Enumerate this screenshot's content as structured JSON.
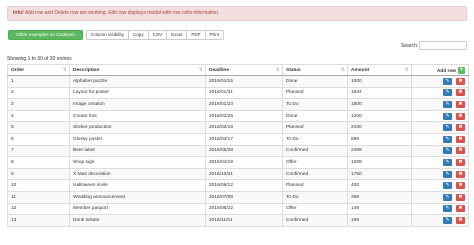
{
  "alert": {
    "strong": "Info!",
    "text": " Add row and Delete row are working. Edit row displays modal with row cells information."
  },
  "toolbar": {
    "examples_label": "Other examples on Codepen",
    "buttons": [
      "Column visibility",
      "Copy",
      "CSV",
      "Excel",
      "PDF",
      "Print"
    ]
  },
  "search": {
    "label": "Search:",
    "value": ""
  },
  "info": "Showing 1 to 30 of 30 entries",
  "table": {
    "headers": [
      "Order",
      "Description",
      "Deadline",
      "Status",
      "Amount"
    ],
    "add_row_label": "Add row",
    "add_icon": "plus-icon",
    "edit_icon": "pencil-icon",
    "delete_icon": "times-icon",
    "colors": {
      "add": "#5cb85c",
      "edit": "#337ab7",
      "delete": "#d9534f"
    },
    "rows": [
      [
        "1",
        "Alphabet puzzle",
        "2016/01/15",
        "Done",
        "1000"
      ],
      [
        "2",
        "Layout for poster",
        "2016/01/31",
        "Planned",
        "1834"
      ],
      [
        "3",
        "Image creation",
        "2016/01/23",
        "To Do",
        "1500"
      ],
      [
        "4",
        "Create font",
        "2016/02/26",
        "Done",
        "1200"
      ],
      [
        "5",
        "Sticker production",
        "2016/02/18",
        "Planned",
        "2100"
      ],
      [
        "6",
        "Glossy poster",
        "2016/03/17",
        "To Do",
        "899"
      ],
      [
        "7",
        "Beer label",
        "2016/05/28",
        "Confirmed",
        "2499"
      ],
      [
        "8",
        "Shop sign",
        "2016/04/19",
        "Offer",
        "1099"
      ],
      [
        "9",
        "X-Mas decoration",
        "2016/10/31",
        "Confirmed",
        "1750"
      ],
      [
        "10",
        "Halloween invite",
        "2016/09/12",
        "Planned",
        "400"
      ],
      [
        "11",
        "Wedding announcement",
        "2016/07/09",
        "To Do",
        "299"
      ],
      [
        "12",
        "Member pasport",
        "2016/06/22",
        "Offer",
        "149"
      ],
      [
        "13",
        "Drink tickets",
        "2016/11/01",
        "Confirmed",
        "199"
      ]
    ]
  }
}
